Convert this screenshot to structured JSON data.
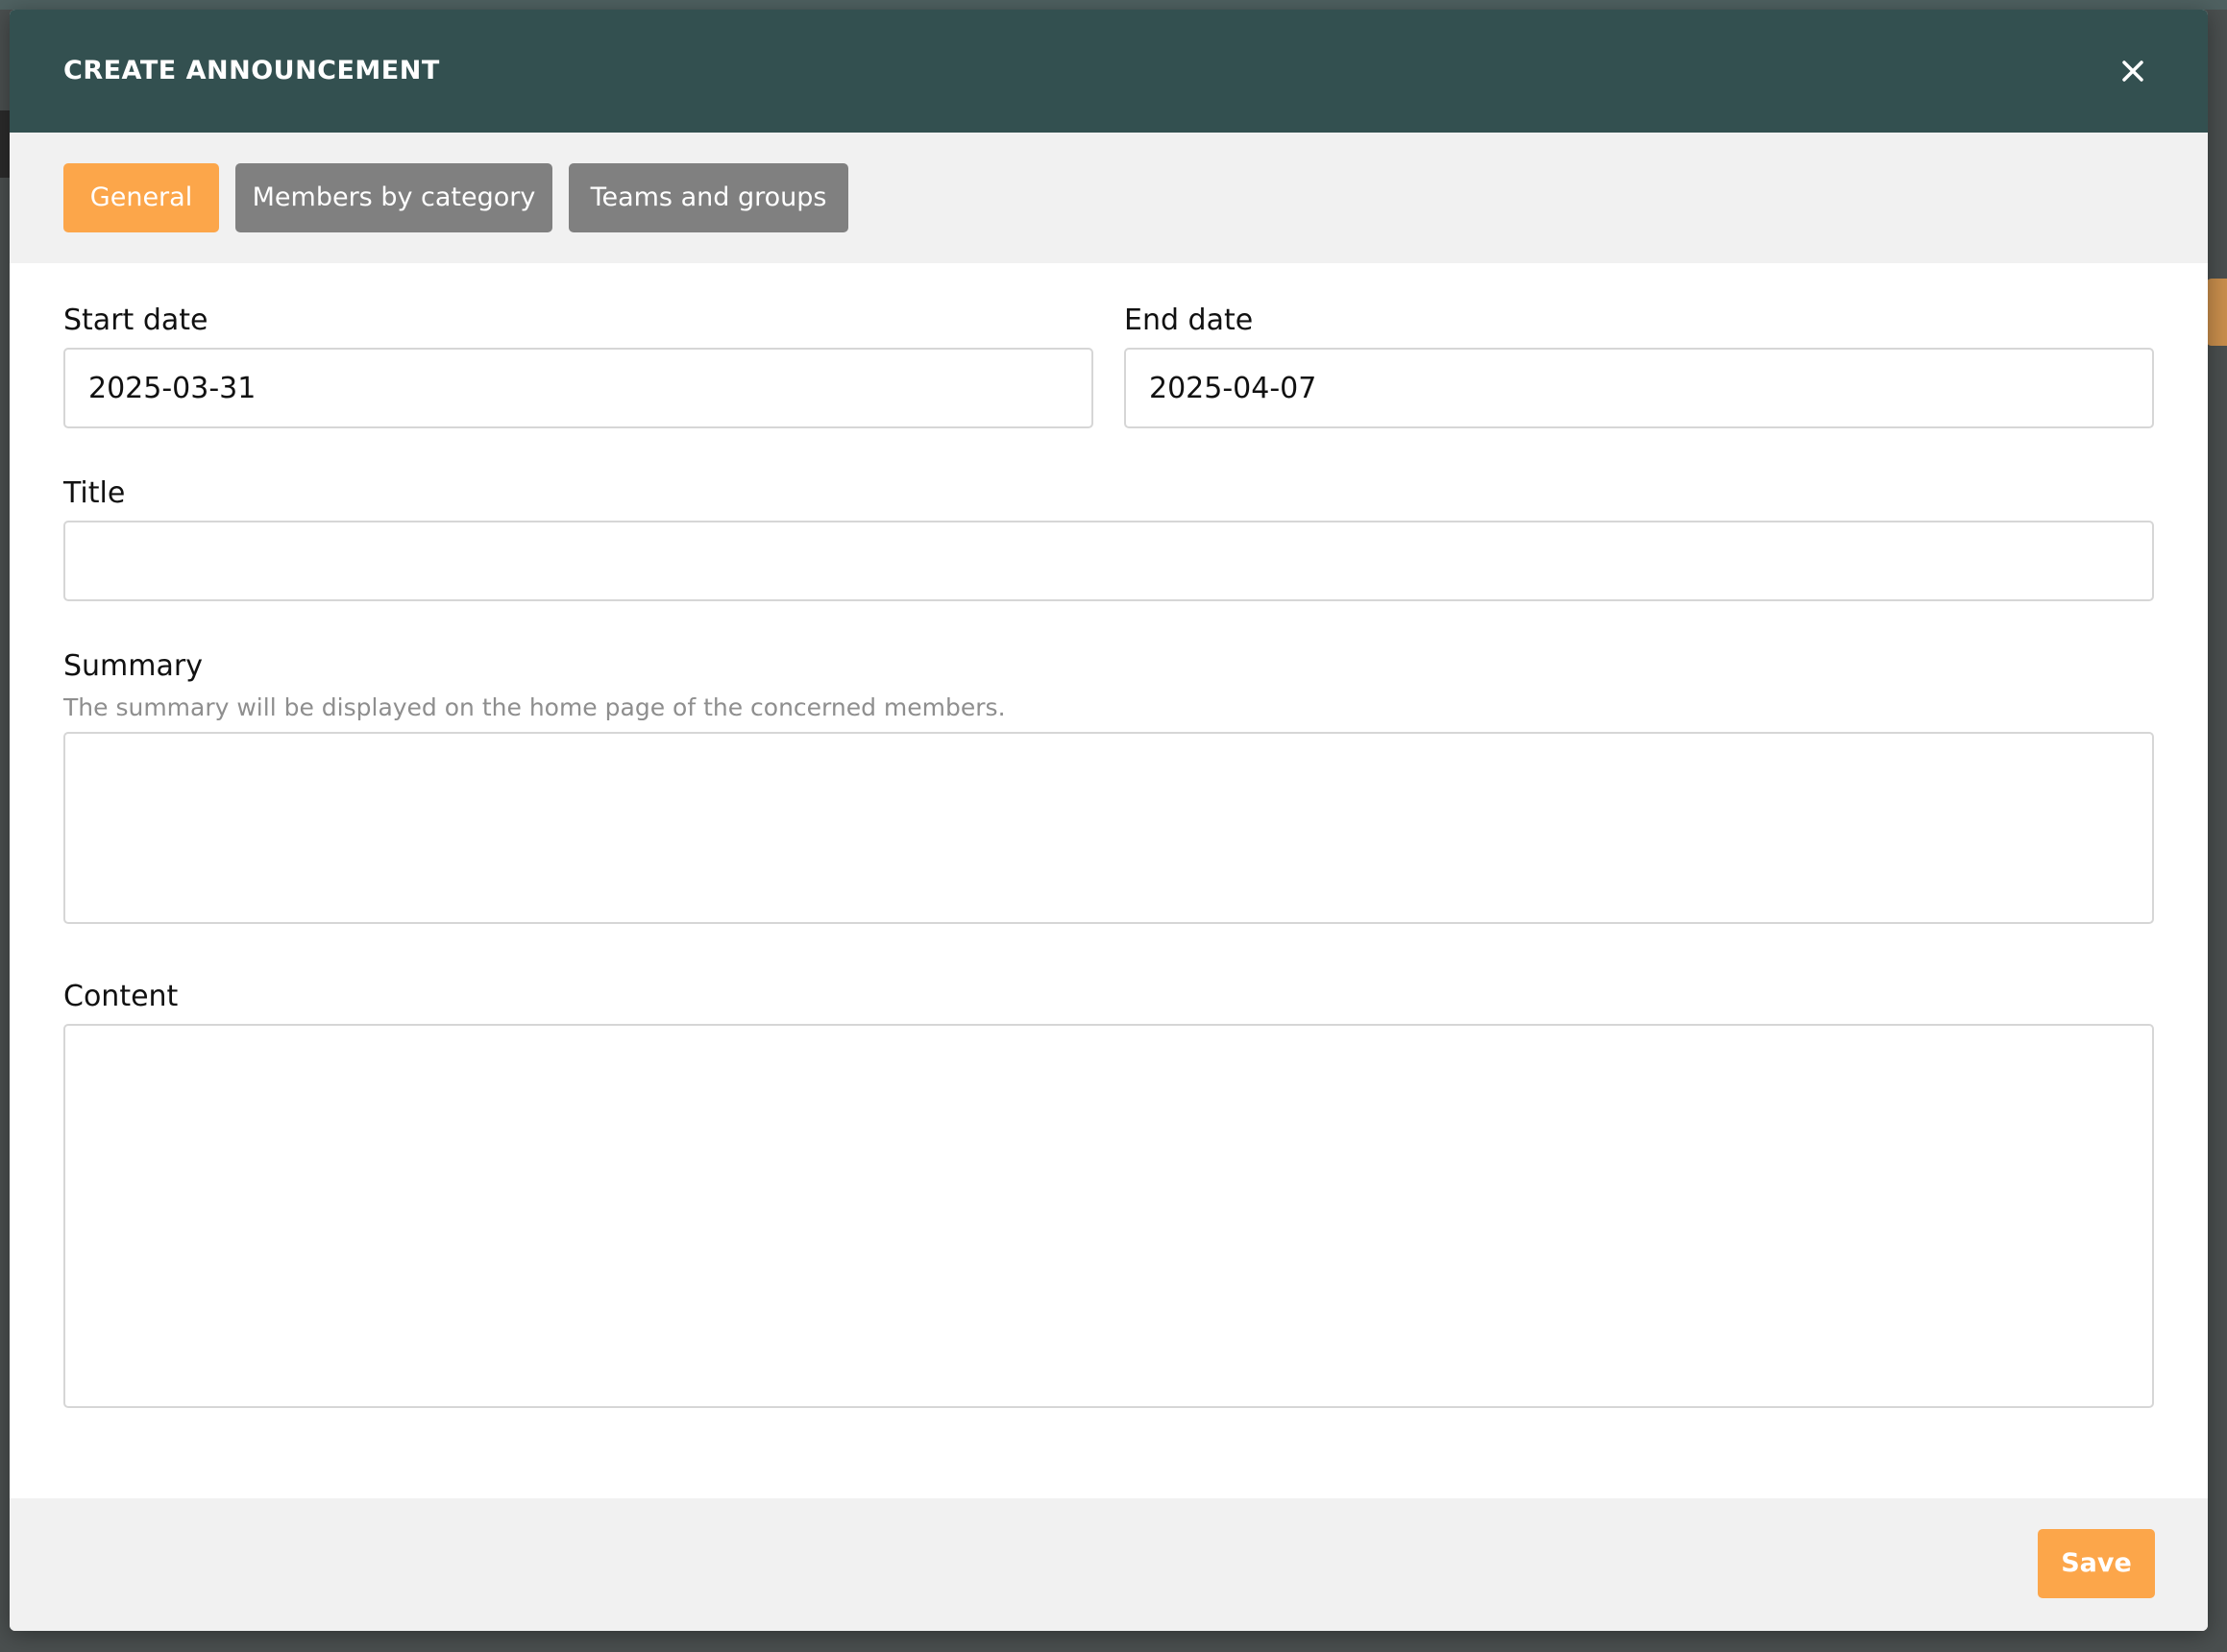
{
  "modal": {
    "title": "CREATE ANNOUNCEMENT",
    "close_icon": "close-icon"
  },
  "tabs": [
    {
      "label": "General",
      "active": true
    },
    {
      "label": "Members by category",
      "active": false
    },
    {
      "label": "Teams and groups",
      "active": false
    }
  ],
  "form": {
    "start_date": {
      "label": "Start date",
      "value": "2025-03-31"
    },
    "end_date": {
      "label": "End date",
      "value": "2025-04-07"
    },
    "title": {
      "label": "Title",
      "value": ""
    },
    "summary": {
      "label": "Summary",
      "help": "The summary will be displayed on the home page of the concerned members.",
      "value": ""
    },
    "content": {
      "label": "Content",
      "value": ""
    }
  },
  "footer": {
    "save_label": "Save"
  },
  "colors": {
    "header": "#335050",
    "accent": "#fca64a",
    "tab_inactive": "#808080",
    "panel": "#f1f1f1"
  }
}
